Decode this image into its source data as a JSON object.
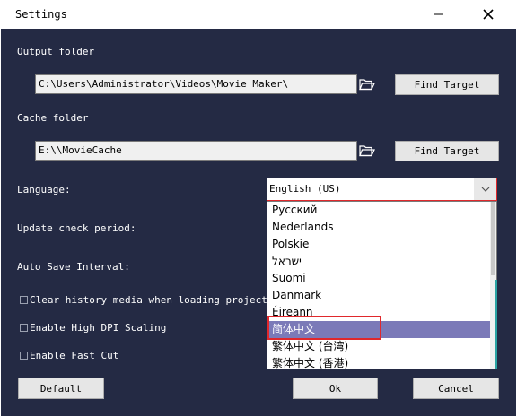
{
  "window": {
    "title": "Settings"
  },
  "output_folder": {
    "label": "Output folder",
    "value": "C:\\Users\\Administrator\\Videos\\Movie Maker\\",
    "button": "Find Target"
  },
  "cache_folder": {
    "label": "Cache folder",
    "value": "E:\\\\MovieCache",
    "button": "Find Target"
  },
  "language": {
    "label": "Language:",
    "selected": "English (US)",
    "options": [
      "Русский",
      "Nederlands",
      "Polskie",
      "ישראל",
      "Suomi",
      "Danmark",
      "Éireann",
      "简体中文",
      "繁体中文 (台湾)",
      "繁体中文 (香港)"
    ],
    "highlighted_index": 7
  },
  "update_check": {
    "label": "Update check period:"
  },
  "auto_save": {
    "label": "Auto Save Interval:"
  },
  "checkboxes": [
    {
      "label": "Clear history media when loading project",
      "checked": false
    },
    {
      "label": "Enable High DPI Scaling",
      "checked": false
    },
    {
      "label": "Enable Fast Cut",
      "checked": false
    }
  ],
  "buttons": {
    "default": "Default",
    "ok": "Ok",
    "cancel": "Cancel"
  },
  "colors": {
    "background": "#242a44",
    "highlight": "#7b7ab8",
    "annotation_red": "#e0282c"
  }
}
